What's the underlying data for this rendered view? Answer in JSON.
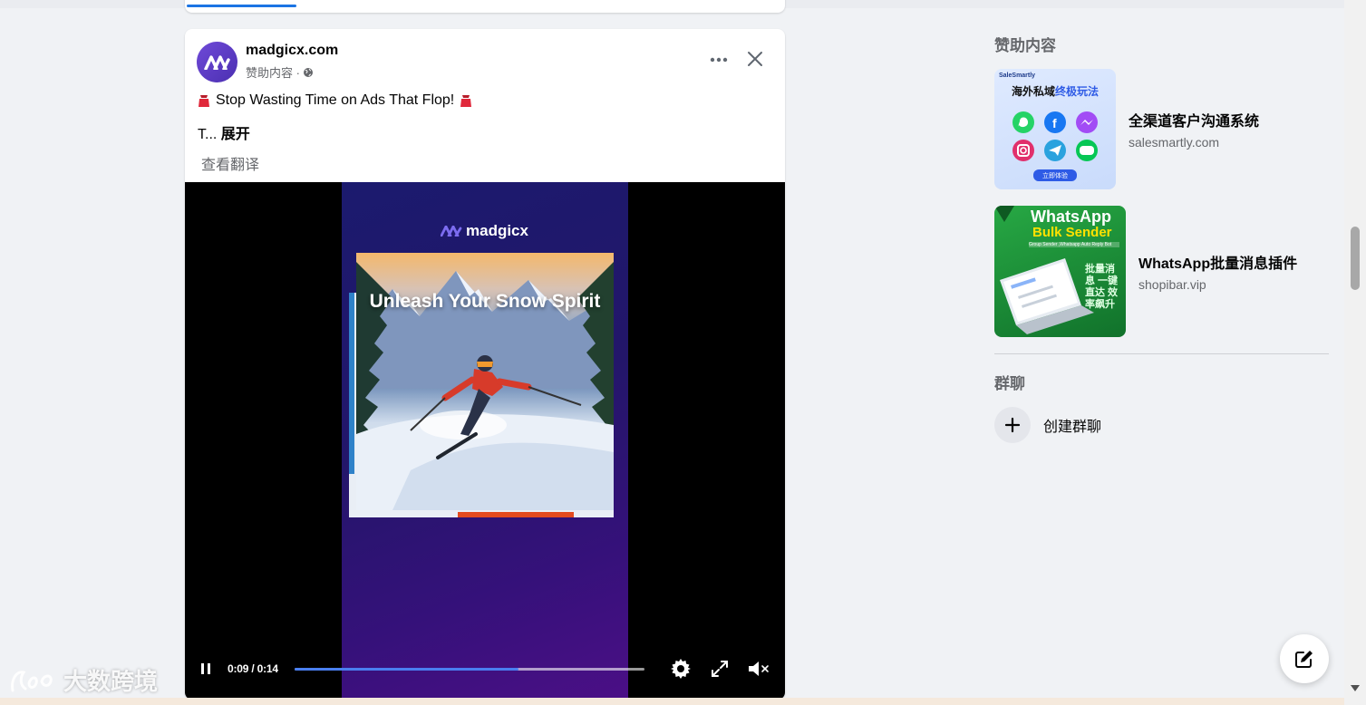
{
  "post": {
    "author": "madgicx.com",
    "meta": "赞助内容 ·",
    "line1": "Stop Wasting Time on Ads That Flop!",
    "line2_prefix": "T... ",
    "expand_label": "展开",
    "translate_label": "查看翻译"
  },
  "video": {
    "brand": "madgicx",
    "headline": "Unleash Your Snow Spirit",
    "time": "0:09 / 0:14",
    "progress": 0.64
  },
  "watermark": "大数跨境",
  "sidebar": {
    "sponsored_title": "赞助内容",
    "ads": [
      {
        "title": "全渠道客户沟通系统",
        "domain": "salesmartly.com",
        "thumb_brand": "SaleSmartly",
        "thumb_headline_a": "海外私域",
        "thumb_headline_b": "终极玩法",
        "thumb_cta": "立即体验"
      },
      {
        "title": "WhatsApp批量消息插件",
        "domain": "shopibar.vip",
        "thumb_line1": "WhatsApp",
        "thumb_line2": "Bulk Sender",
        "thumb_line3": "Group Sender ,Whatsapp Auto Reply Bot",
        "thumb_chars": "批量消息 一键直达 效率飙升"
      }
    ],
    "groups_title": "群聊",
    "create_group_label": "创建群聊"
  },
  "colors": {
    "accent": "#1b74e4",
    "progress": "#4a7ff0",
    "whatsapp_green": "#1f8f3a"
  },
  "icons": [
    "globe-icon",
    "more-icon",
    "close-icon",
    "pause-icon",
    "settings-icon",
    "fullscreen-icon",
    "mute-icon",
    "plus-icon",
    "compose-icon"
  ]
}
